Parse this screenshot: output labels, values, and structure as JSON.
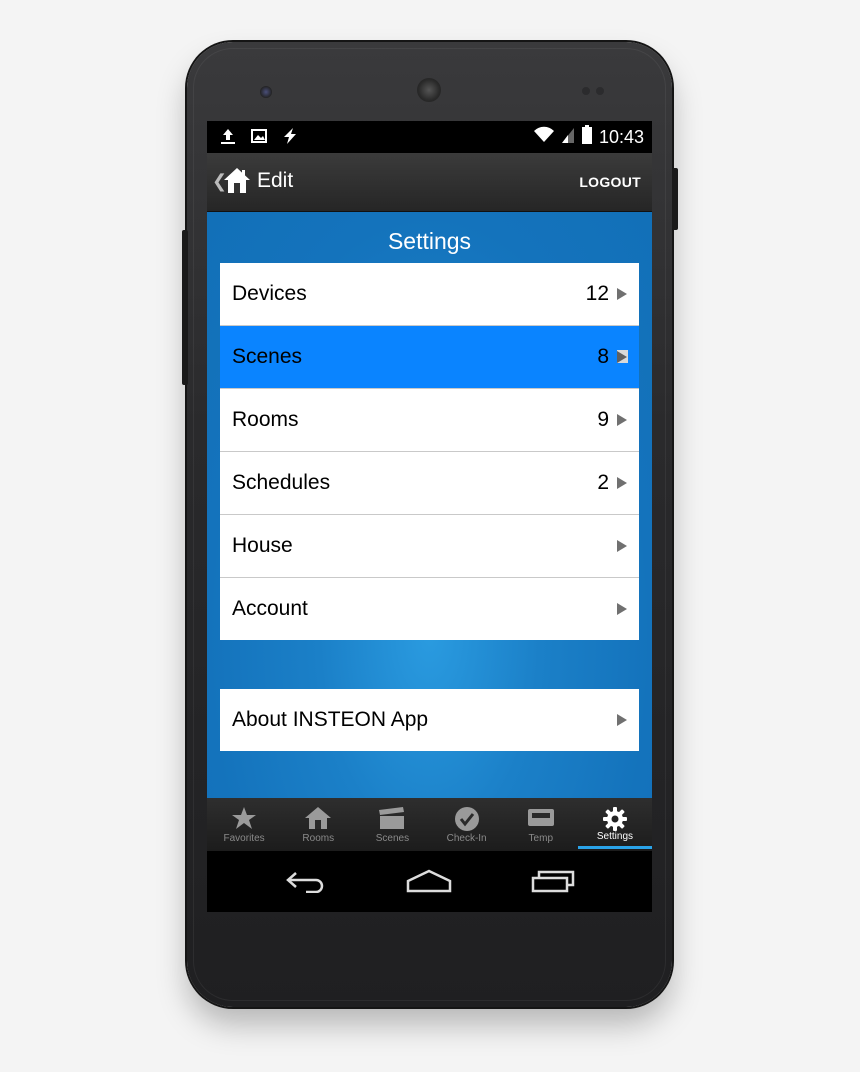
{
  "status_bar": {
    "time": "10:43",
    "left_icons": [
      "upload-icon",
      "image-icon",
      "bolt-icon"
    ],
    "right_icons": [
      "wifi-icon",
      "signal-icon",
      "battery-icon"
    ]
  },
  "action_bar": {
    "title": "Edit",
    "logout_label": "LOGOUT"
  },
  "settings": {
    "title": "Settings",
    "items": [
      {
        "label": "Devices",
        "count": "12",
        "selected": false
      },
      {
        "label": "Scenes",
        "count": "8",
        "selected": true
      },
      {
        "label": "Rooms",
        "count": "9",
        "selected": false
      },
      {
        "label": "Schedules",
        "count": "2",
        "selected": false
      },
      {
        "label": "House",
        "count": "",
        "selected": false
      },
      {
        "label": "Account",
        "count": "",
        "selected": false
      }
    ],
    "about": {
      "label": "About INSTEON App"
    }
  },
  "tabs": [
    {
      "label": "Favorites",
      "icon": "star-icon",
      "active": false
    },
    {
      "label": "Rooms",
      "icon": "house-icon",
      "active": false
    },
    {
      "label": "Scenes",
      "icon": "clapperboard-icon",
      "active": false
    },
    {
      "label": "Check-In",
      "icon": "check-circle-icon",
      "active": false
    },
    {
      "label": "Temp",
      "icon": "thermostat-icon",
      "active": false
    },
    {
      "label": "Settings",
      "icon": "gear-icon",
      "active": true
    }
  ],
  "colors": {
    "content_blue": "#1473bc",
    "selected_row": "#0a84ff",
    "active_tab_underline": "#2aa3e8"
  }
}
